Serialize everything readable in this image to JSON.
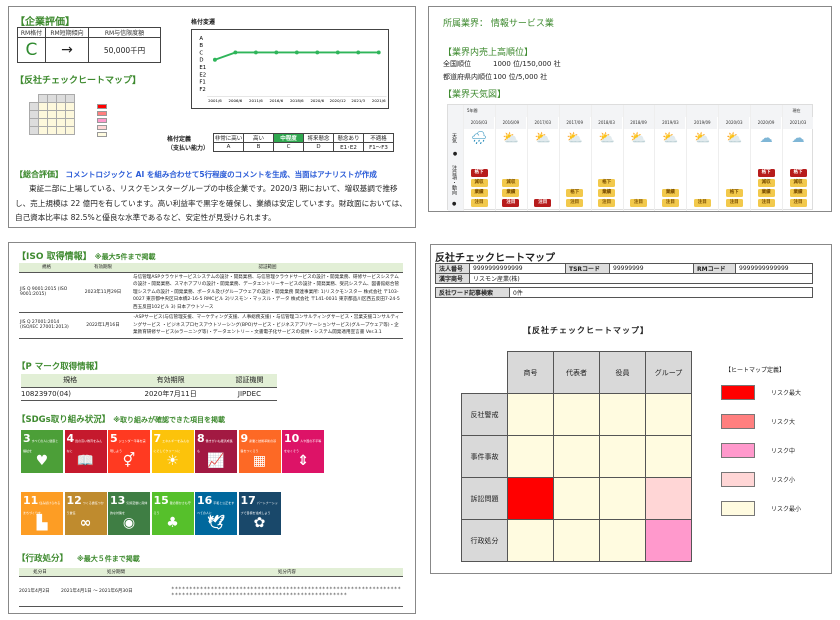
{
  "evaluation": {
    "title": "【企業評価】",
    "rm_headers": [
      "RM格付",
      "RM短期傾向",
      "RM与信限度額"
    ],
    "rm_values": [
      "C",
      "→",
      "50,000千円"
    ],
    "heatmap_title": "【反社チェックヒートマップ】",
    "chart_title": "格付変遷",
    "grade_label_line1": "格付定義",
    "grade_label_line2": "（支払い能力）",
    "grade_headers": [
      "非常に高い",
      "高い",
      "中程度",
      "将来懸念",
      "懸念あり",
      "不適格"
    ],
    "grade_codes": [
      "A",
      "B",
      "C",
      "D",
      "E1･E2",
      "F1～F3"
    ],
    "highlight_index": 2,
    "summary_label": "【総合評価】",
    "summary_note": "コメントロジックと AI を組み合わせて5行程度のコメントを生成、当面はアナリストが作成",
    "summary_text": "東証二部に上場している、リスクモンスターグループの中核企業です。2020/3 期において、増収基調で推移し、売上規模は 22 億円を有しています。高い利益率で黒字を確保し、業績は安定しています。財政面においては、自己資本比率は 82.5%と優良な水準であるなど、安定性が見受けられます。"
  },
  "chart_data": {
    "type": "line",
    "title": "格付変遷",
    "x": [
      "2001/6",
      "2006/6",
      "2011/6",
      "2016/6",
      "2018/6",
      "2020/6",
      "2020/12",
      "2021/3",
      "2021/6"
    ],
    "y_categories": [
      "A",
      "B",
      "C",
      "D",
      "E1",
      "E2",
      "F1",
      "F2"
    ],
    "values": [
      "D",
      "C",
      "C",
      "C",
      "C",
      "C",
      "C",
      "C",
      "C"
    ],
    "color": "#2fb55a",
    "grid": false
  },
  "industry": {
    "sector_label": "所属業界：",
    "sector": "情報サービス業",
    "rank_title": "【業界内売上高順位】",
    "national_label": "全国順位",
    "national_value": "1000 位/150,000 社",
    "pref_label": "都道府県内順位",
    "pref_value": "100 位/5,000 社",
    "weather_title": "【業界天気図】",
    "period_label": "5年間",
    "current_label": "現在",
    "row_weather": "天気",
    "row_notes": "注目項・動向",
    "columns": [
      {
        "date": "2016/03",
        "weather": "rain",
        "tags": [
          [
            "格下",
            "r"
          ],
          [
            "減収",
            "y"
          ],
          [
            "業績",
            "y"
          ],
          [
            "注目",
            "y"
          ]
        ]
      },
      {
        "date": "2016/09",
        "weather": "partly",
        "tags": [
          [
            "減収",
            "y"
          ],
          [
            "業績",
            "y"
          ],
          [
            "注目",
            "r"
          ]
        ]
      },
      {
        "date": "2017/03",
        "weather": "partly",
        "tags": [
          [
            "注目",
            "r"
          ]
        ]
      },
      {
        "date": "2017/09",
        "weather": "partly",
        "tags": [
          [
            "格下",
            "y"
          ],
          [
            "注目",
            "y"
          ]
        ]
      },
      {
        "date": "2018/03",
        "weather": "partly",
        "tags": [
          [
            "格下",
            "y"
          ],
          [
            "業績",
            "y"
          ],
          [
            "注目",
            "y"
          ]
        ]
      },
      {
        "date": "2018/09",
        "weather": "partly",
        "tags": [
          [
            "注目",
            "y"
          ]
        ]
      },
      {
        "date": "2019/03",
        "weather": "partly",
        "tags": [
          [
            "業績",
            "y"
          ],
          [
            "注目",
            "y"
          ]
        ]
      },
      {
        "date": "2019/09",
        "weather": "partly",
        "tags": [
          [
            "注目",
            "y"
          ]
        ]
      },
      {
        "date": "2020/03",
        "weather": "partly",
        "tags": [
          [
            "格下",
            "y"
          ],
          [
            "注目",
            "y"
          ]
        ]
      },
      {
        "date": "2020/09",
        "weather": "cloudy",
        "tags": [
          [
            "格下",
            "r"
          ],
          [
            "減収",
            "y"
          ],
          [
            "業績",
            "y"
          ],
          [
            "注目",
            "y"
          ]
        ]
      },
      {
        "date": "2021/03",
        "weather": "cloudy",
        "tags": [
          [
            "格下",
            "r"
          ],
          [
            "減収",
            "y"
          ],
          [
            "業績",
            "y"
          ],
          [
            "注目",
            "y"
          ]
        ]
      }
    ]
  },
  "iso": {
    "title": "【ISO 取得情報】",
    "note": "※最大5件まで掲載",
    "headers": [
      "規格",
      "有効期限",
      "認証範囲"
    ],
    "rows": [
      {
        "standard": "JIS Q 9001:2015 (ISO 9001:2015)",
        "expiry": "2023年11月29日",
        "scope": "与信管理ASPクラウドサービスシステムの設計・開発業務、与信管理クラウドサービスの設計・開発業務、研修サービスシステムの設計・開発業務、スマホアプリの設計・開発業務、データエントリーサービスの設計・開発業務、受託システム、図書館総合管理システムの設計・開発業務、ポータル及びグループウェアの設計・開発業務 関連事業所: 1)リスクモンスター 株式会社 〒103-0027 東京都中央区日本橋2-16-5 RMCビル 2)リスモン・マッスル・データ 株式会社 〒141-0031 東京都品川区西五反田7-24-5 西五反田102ビル 3) 日本アウトソース"
      },
      {
        "standard": "JIS Q 27001:2014 (ISO/IEC 27001:2013)",
        "expiry": "2022年1月16日",
        "scope": "･ASPサービス(与信管理支援、マーケティング支援、人事総務支援)・与信管理コンサルティングサービス・営業支援コンサルティングサービス ・ビジネスプロセスアウトソーシング(BPO)サービス・ビジネスアプリケーションサービス(グループウェア等)・企業教育研修サービス(eラーニング等)・データエントリー・文書電子化サービスの提供・システム開発適用宣言書 Ver.3.1"
      }
    ]
  },
  "pmark": {
    "title": "【P マーク取得情報】",
    "headers": [
      "規格",
      "有効期限",
      "認証機関"
    ],
    "row": [
      "10823970(04)",
      "2020年7月11日",
      "JIPDEC"
    ]
  },
  "sdgs": {
    "title": "【SDGs取り組み状況】",
    "note": "※取り組みが確認できた項目を掲載",
    "goals": [
      {
        "num": "3",
        "label": "すべての人に健康と福祉を",
        "icon": "♥",
        "color": "#4c9f38"
      },
      {
        "num": "4",
        "label": "質の高い教育をみんなに",
        "icon": "📖",
        "color": "#c5192d"
      },
      {
        "num": "5",
        "label": "ジェンダー平等を実現しよう",
        "icon": "⚥",
        "color": "#ff3a21"
      },
      {
        "num": "7",
        "label": "エネルギーをみんなにそしてクリーンに",
        "icon": "☀",
        "color": "#fcc30b"
      },
      {
        "num": "8",
        "label": "働きがいも経済成長も",
        "icon": "📈",
        "color": "#a21942"
      },
      {
        "num": "9",
        "label": "産業と技術革新の基盤をつくろう",
        "icon": "▦",
        "color": "#fd6925"
      },
      {
        "num": "10",
        "label": "人や国の不平等をなくそう",
        "icon": "⇕",
        "color": "#dd1367"
      },
      {
        "num": "11",
        "label": "住み続けられるまちづくりを",
        "icon": "▙",
        "color": "#fd9d24"
      },
      {
        "num": "12",
        "label": "つくる責任つかう責任",
        "icon": "∞",
        "color": "#bf8b2e"
      },
      {
        "num": "13",
        "label": "気候変動に具体的な対策を",
        "icon": "◉",
        "color": "#3f7e44"
      },
      {
        "num": "15",
        "label": "陸の豊かさも守ろう",
        "icon": "♣",
        "color": "#56c02b"
      },
      {
        "num": "16",
        "label": "平和と公正をすべての人に",
        "icon": "🕊",
        "color": "#00689d"
      },
      {
        "num": "17",
        "label": "パートナーシップで目標を達成しよう",
        "icon": "✿",
        "color": "#19486a"
      }
    ]
  },
  "admin": {
    "title": "【行政処分】",
    "note": "※最大５件まで掲載",
    "headers": [
      "処分日",
      "処分期間",
      "処分内容"
    ],
    "row": {
      "date": "2021年4月2日",
      "period": "2021年4月1日 ～ 2021年6月30日",
      "content": "＊＊＊＊＊＊＊＊＊＊＊＊＊＊＊＊＊＊＊＊＊＊＊＊＊＊＊＊＊＊＊＊＊＊＊＊＊＊＊＊＊＊＊＊＊＊＊＊＊＊＊＊＊＊＊＊＊＊＊＊＊＊＊＊＊＊＊＊＊＊＊＊＊＊＊＊＊＊＊＊＊＊＊＊＊＊＊＊＊＊＊＊＊＊＊＊＊＊＊＊＊＊＊＊＊＊＊＊＊＊＊＊＊"
    }
  },
  "heatmap": {
    "title": "反社チェックヒートマップ",
    "corp_no_label": "法人番号",
    "corp_no": "9999999999999",
    "tsr_label": "TSRコード",
    "tsr": "99999999",
    "rm_label": "RMコード",
    "rm": "9999999999999",
    "kanji_label": "漢字商号",
    "kanji": "リスモン産業(株)",
    "search_label": "反社ワード記事検索",
    "search": "0件",
    "chart_title": "【反社チェックヒートマップ】",
    "columns": [
      "商号",
      "代表者",
      "役員",
      "グループ"
    ],
    "rows": [
      "反社警戒",
      "事件事故",
      "訴訟問題",
      "行政処分"
    ],
    "levels": [
      [
        4,
        4,
        4,
        4
      ],
      [
        4,
        4,
        4,
        4
      ],
      [
        0,
        4,
        4,
        3
      ],
      [
        4,
        4,
        4,
        2
      ]
    ],
    "legend_title": "【ヒートマップ定義】",
    "legend": [
      {
        "label": "リスク最大",
        "color": "#ff0000"
      },
      {
        "label": "リスク大",
        "color": "#ff7f7f"
      },
      {
        "label": "リスク中",
        "color": "#ff99cc"
      },
      {
        "label": "リスク小",
        "color": "#ffd6d6"
      },
      {
        "label": "リスク最小",
        "color": "#fffbe0"
      }
    ]
  }
}
